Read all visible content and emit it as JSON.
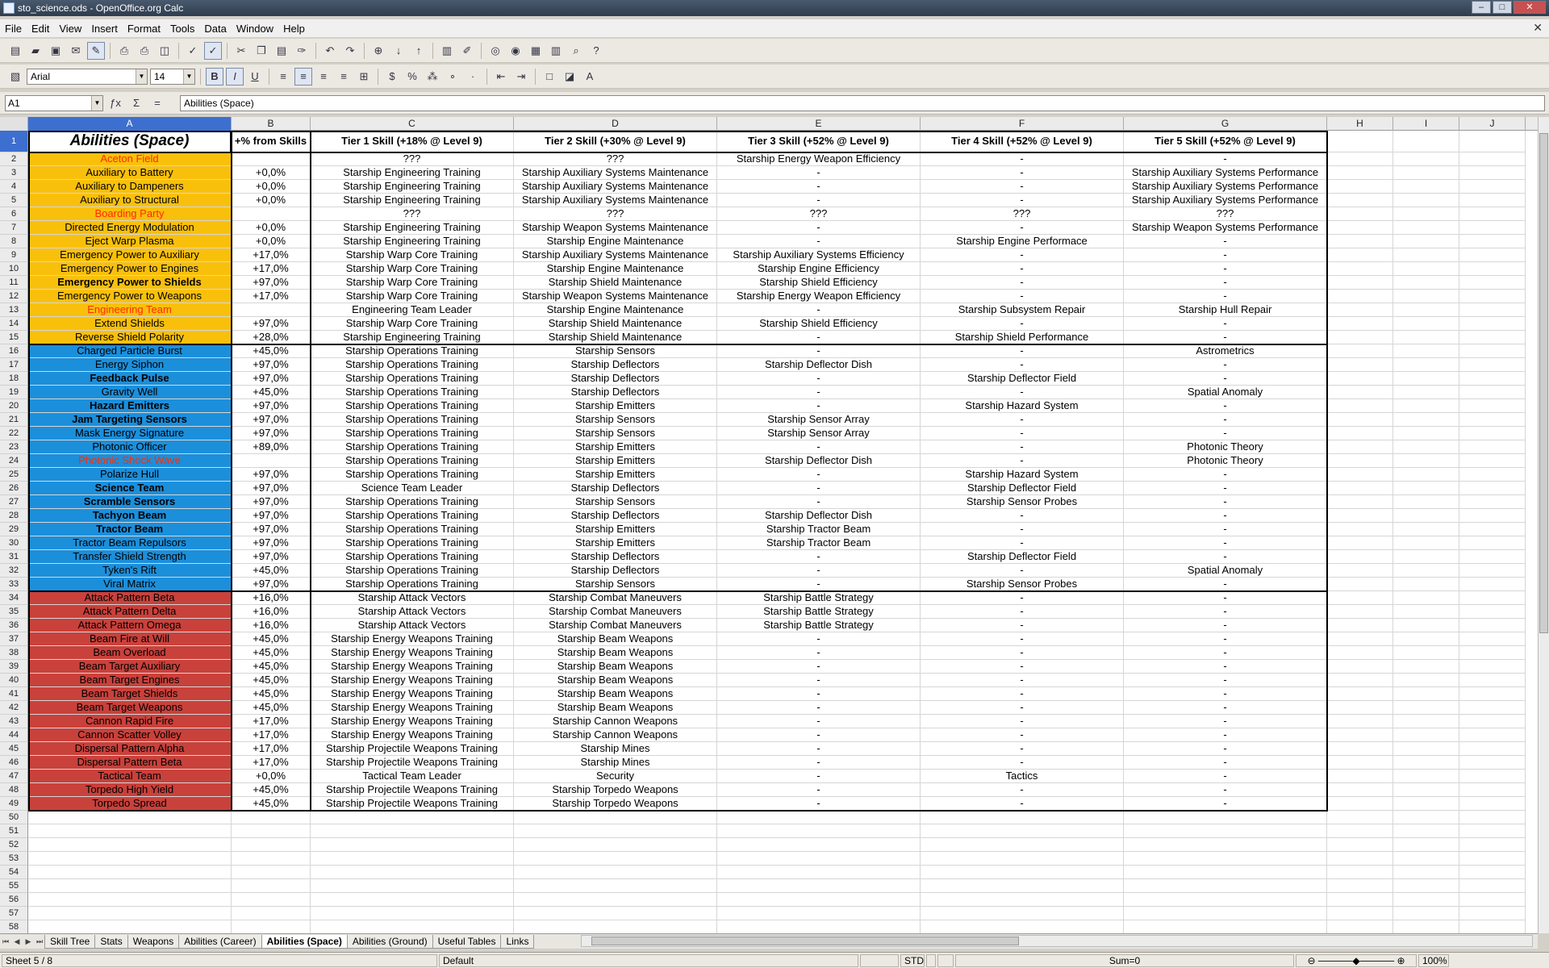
{
  "window": {
    "title": "sto_science.ods - OpenOffice.org Calc"
  },
  "menu": [
    "File",
    "Edit",
    "View",
    "Insert",
    "Format",
    "Tools",
    "Data",
    "Window",
    "Help"
  ],
  "format": {
    "font": "Arial",
    "size": "14"
  },
  "formula": {
    "cellref": "A1",
    "content": "Abilities (Space)"
  },
  "columns": [
    "A",
    "B",
    "C",
    "D",
    "E",
    "F",
    "G",
    "H",
    "I",
    "J"
  ],
  "headers": {
    "A": "Abilities (Space)",
    "B": "+% from Skills",
    "C": "Tier 1 Skill (+18% @ Level 9)",
    "D": "Tier 2 Skill (+30% @ Level 9)",
    "E": "Tier 3 Skill (+52% @ Level 9)",
    "F": "Tier 4 Skill (+52% @ Level 9)",
    "G": "Tier 5 Skill (+52% @ Level 9)"
  },
  "rows": [
    [
      "Aceton Field",
      "",
      "???",
      "???",
      "Starship Energy Weapon Efficiency",
      "-",
      "-"
    ],
    [
      "Auxiliary to Battery",
      "+0,0%",
      "Starship Engineering Training",
      "Starship Auxiliary Systems Maintenance",
      "-",
      "-",
      "Starship Auxiliary Systems Performance"
    ],
    [
      "Auxiliary to Dampeners",
      "+0,0%",
      "Starship Engineering Training",
      "Starship Auxiliary Systems Maintenance",
      "-",
      "-",
      "Starship Auxiliary Systems Performance"
    ],
    [
      "Auxiliary to Structural",
      "+0,0%",
      "Starship Engineering Training",
      "Starship Auxiliary Systems Maintenance",
      "-",
      "-",
      "Starship Auxiliary Systems Performance"
    ],
    [
      "Boarding Party",
      "",
      "???",
      "???",
      "???",
      "???",
      "???"
    ],
    [
      "Directed Energy Modulation",
      "+0,0%",
      "Starship Engineering Training",
      "Starship Weapon Systems Maintenance",
      "-",
      "-",
      "Starship Weapon Systems Performance"
    ],
    [
      "Eject Warp Plasma",
      "+0,0%",
      "Starship Engineering Training",
      "Starship Engine Maintenance",
      "-",
      "Starship Engine Performace",
      "-"
    ],
    [
      "Emergency Power to Auxiliary",
      "+17,0%",
      "Starship Warp Core Training",
      "Starship Auxiliary Systems Maintenance",
      "Starship Auxiliary Systems Efficiency",
      "-",
      "-"
    ],
    [
      "Emergency Power to Engines",
      "+17,0%",
      "Starship Warp Core Training",
      "Starship Engine Maintenance",
      "Starship Engine Efficiency",
      "-",
      "-"
    ],
    [
      "Emergency Power to Shields",
      "+97,0%",
      "Starship Warp Core Training",
      "Starship Shield Maintenance",
      "Starship Shield Efficiency",
      "-",
      "-"
    ],
    [
      "Emergency Power to Weapons",
      "+17,0%",
      "Starship Warp Core Training",
      "Starship Weapon Systems Maintenance",
      "Starship Energy Weapon Efficiency",
      "-",
      "-"
    ],
    [
      "Engineering Team",
      "",
      "Engineering Team Leader",
      "Starship Engine Maintenance",
      "-",
      "Starship Subsystem Repair",
      "Starship Hull Repair"
    ],
    [
      "Extend Shields",
      "+97,0%",
      "Starship Warp Core Training",
      "Starship Shield Maintenance",
      "Starship Shield Efficiency",
      "-",
      "-"
    ],
    [
      "Reverse Shield Polarity",
      "+28,0%",
      "Starship Engineering Training",
      "Starship Shield Maintenance",
      "-",
      "Starship Shield Performance",
      "-"
    ],
    [
      "Charged Particle Burst",
      "+45,0%",
      "Starship Operations Training",
      "Starship Sensors",
      "-",
      "-",
      "Astrometrics"
    ],
    [
      "Energy Siphon",
      "+97,0%",
      "Starship Operations Training",
      "Starship Deflectors",
      "Starship Deflector Dish",
      "-",
      "-"
    ],
    [
      "Feedback Pulse",
      "+97,0%",
      "Starship Operations Training",
      "Starship Deflectors",
      "-",
      "Starship Deflector Field",
      "-"
    ],
    [
      "Gravity Well",
      "+45,0%",
      "Starship Operations Training",
      "Starship Deflectors",
      "-",
      "-",
      "Spatial Anomaly"
    ],
    [
      "Hazard Emitters",
      "+97,0%",
      "Starship Operations Training",
      "Starship Emitters",
      "-",
      "Starship Hazard System",
      "-"
    ],
    [
      "Jam Targeting Sensors",
      "+97,0%",
      "Starship Operations Training",
      "Starship Sensors",
      "Starship Sensor Array",
      "-",
      "-"
    ],
    [
      "Mask Energy Signature",
      "+97,0%",
      "Starship Operations Training",
      "Starship Sensors",
      "Starship Sensor Array",
      "-",
      "-"
    ],
    [
      "Photonic Officer",
      "+89,0%",
      "Starship Operations Training",
      "Starship Emitters",
      "-",
      "-",
      "Photonic Theory"
    ],
    [
      "Photonic Shock Wave",
      "",
      "Starship Operations Training",
      "Starship Emitters",
      "Starship Deflector Dish",
      "-",
      "Photonic Theory"
    ],
    [
      "Polarize Hull",
      "+97,0%",
      "Starship Operations Training",
      "Starship Emitters",
      "-",
      "Starship Hazard System",
      "-"
    ],
    [
      "Science Team",
      "+97,0%",
      "Science Team Leader",
      "Starship Deflectors",
      "-",
      "Starship Deflector Field",
      "-"
    ],
    [
      "Scramble Sensors",
      "+97,0%",
      "Starship Operations Training",
      "Starship Sensors",
      "-",
      "Starship Sensor Probes",
      "-"
    ],
    [
      "Tachyon Beam",
      "+97,0%",
      "Starship Operations Training",
      "Starship Deflectors",
      "Starship Deflector Dish",
      "-",
      "-"
    ],
    [
      "Tractor Beam",
      "+97,0%",
      "Starship Operations Training",
      "Starship Emitters",
      "Starship Tractor Beam",
      "-",
      "-"
    ],
    [
      "Tractor Beam Repulsors",
      "+97,0%",
      "Starship Operations Training",
      "Starship Emitters",
      "Starship Tractor Beam",
      "-",
      "-"
    ],
    [
      "Transfer Shield Strength",
      "+97,0%",
      "Starship Operations Training",
      "Starship Deflectors",
      "-",
      "Starship Deflector Field",
      "-"
    ],
    [
      "Tyken's Rift",
      "+45,0%",
      "Starship Operations Training",
      "Starship Deflectors",
      "-",
      "-",
      "Spatial Anomaly"
    ],
    [
      "Viral Matrix",
      "+97,0%",
      "Starship Operations Training",
      "Starship Sensors",
      "-",
      "Starship Sensor Probes",
      "-"
    ],
    [
      "Attack Pattern Beta",
      "+16,0%",
      "Starship Attack Vectors",
      "Starship Combat Maneuvers",
      "Starship Battle Strategy",
      "-",
      "-"
    ],
    [
      "Attack Pattern Delta",
      "+16,0%",
      "Starship Attack Vectors",
      "Starship Combat Maneuvers",
      "Starship Battle Strategy",
      "-",
      "-"
    ],
    [
      "Attack Pattern Omega",
      "+16,0%",
      "Starship Attack Vectors",
      "Starship Combat Maneuvers",
      "Starship Battle Strategy",
      "-",
      "-"
    ],
    [
      "Beam Fire at Will",
      "+45,0%",
      "Starship Energy Weapons Training",
      "Starship Beam Weapons",
      "-",
      "-",
      "-"
    ],
    [
      "Beam Overload",
      "+45,0%",
      "Starship Energy Weapons Training",
      "Starship Beam Weapons",
      "-",
      "-",
      "-"
    ],
    [
      "Beam Target Auxiliary",
      "+45,0%",
      "Starship Energy Weapons Training",
      "Starship Beam Weapons",
      "-",
      "-",
      "-"
    ],
    [
      "Beam Target Engines",
      "+45,0%",
      "Starship Energy Weapons Training",
      "Starship Beam Weapons",
      "-",
      "-",
      "-"
    ],
    [
      "Beam Target Shields",
      "+45,0%",
      "Starship Energy Weapons Training",
      "Starship Beam Weapons",
      "-",
      "-",
      "-"
    ],
    [
      "Beam Target Weapons",
      "+45,0%",
      "Starship Energy Weapons Training",
      "Starship Beam Weapons",
      "-",
      "-",
      "-"
    ],
    [
      "Cannon Rapid Fire",
      "+17,0%",
      "Starship Energy Weapons Training",
      "Starship Cannon Weapons",
      "-",
      "-",
      "-"
    ],
    [
      "Cannon Scatter Volley",
      "+17,0%",
      "Starship Energy Weapons Training",
      "Starship Cannon Weapons",
      "-",
      "-",
      "-"
    ],
    [
      "Dispersal Pattern Alpha",
      "+17,0%",
      "Starship Projectile Weapons Training",
      "Starship Mines",
      "-",
      "-",
      "-"
    ],
    [
      "Dispersal Pattern Beta",
      "+17,0%",
      "Starship Projectile Weapons Training",
      "Starship Mines",
      "-",
      "-",
      "-"
    ],
    [
      "Tactical Team",
      "+0,0%",
      "Tactical Team Leader",
      "Security",
      "-",
      "Tactics",
      "-"
    ],
    [
      "Torpedo High Yield",
      "+45,0%",
      "Starship Projectile Weapons Training",
      "Starship Torpedo Weapons",
      "-",
      "-",
      "-"
    ],
    [
      "Torpedo Spread",
      "+45,0%",
      "Starship Projectile Weapons Training",
      "Starship Torpedo Weapons",
      "-",
      "-",
      "-"
    ]
  ],
  "row_styles": {
    "colors": {
      "yellow": "#f9c00b",
      "blue": "#1c8fdb",
      "red": "#c9413b",
      "red_text": "#ff2a00"
    },
    "group": [
      "yellow",
      "yellow",
      "yellow",
      "yellow",
      "yellow",
      "yellow",
      "yellow",
      "yellow",
      "yellow",
      "yellow",
      "yellow",
      "yellow",
      "yellow",
      "yellow",
      "blue",
      "blue",
      "blue",
      "blue",
      "blue",
      "blue",
      "blue",
      "blue",
      "blue",
      "blue",
      "blue",
      "blue",
      "blue",
      "blue",
      "blue",
      "blue",
      "blue",
      "blue",
      "red",
      "red",
      "red",
      "red",
      "red",
      "red",
      "red",
      "red",
      "red",
      "red",
      "red",
      "red",
      "red",
      "red",
      "red",
      "red"
    ],
    "red_text_rows": [
      2,
      6,
      13,
      24
    ],
    "bold_rows": [
      11,
      18,
      20,
      21,
      26,
      27,
      28,
      29
    ]
  },
  "empty_row_numbers": [
    "50",
    "51",
    "52",
    "53",
    "54",
    "55",
    "56",
    "57",
    "58"
  ],
  "sheet_tabs": [
    "Skill Tree",
    "Stats",
    "Weapons",
    "Abilities (Career)",
    "Abilities (Space)",
    "Abilities (Ground)",
    "Useful Tables",
    "Links"
  ],
  "active_tab": "Abilities (Space)",
  "status": {
    "sheet": "Sheet 5 / 8",
    "style": "Default",
    "mode": "STD",
    "sum": "Sum=0",
    "zoom": "100%"
  }
}
